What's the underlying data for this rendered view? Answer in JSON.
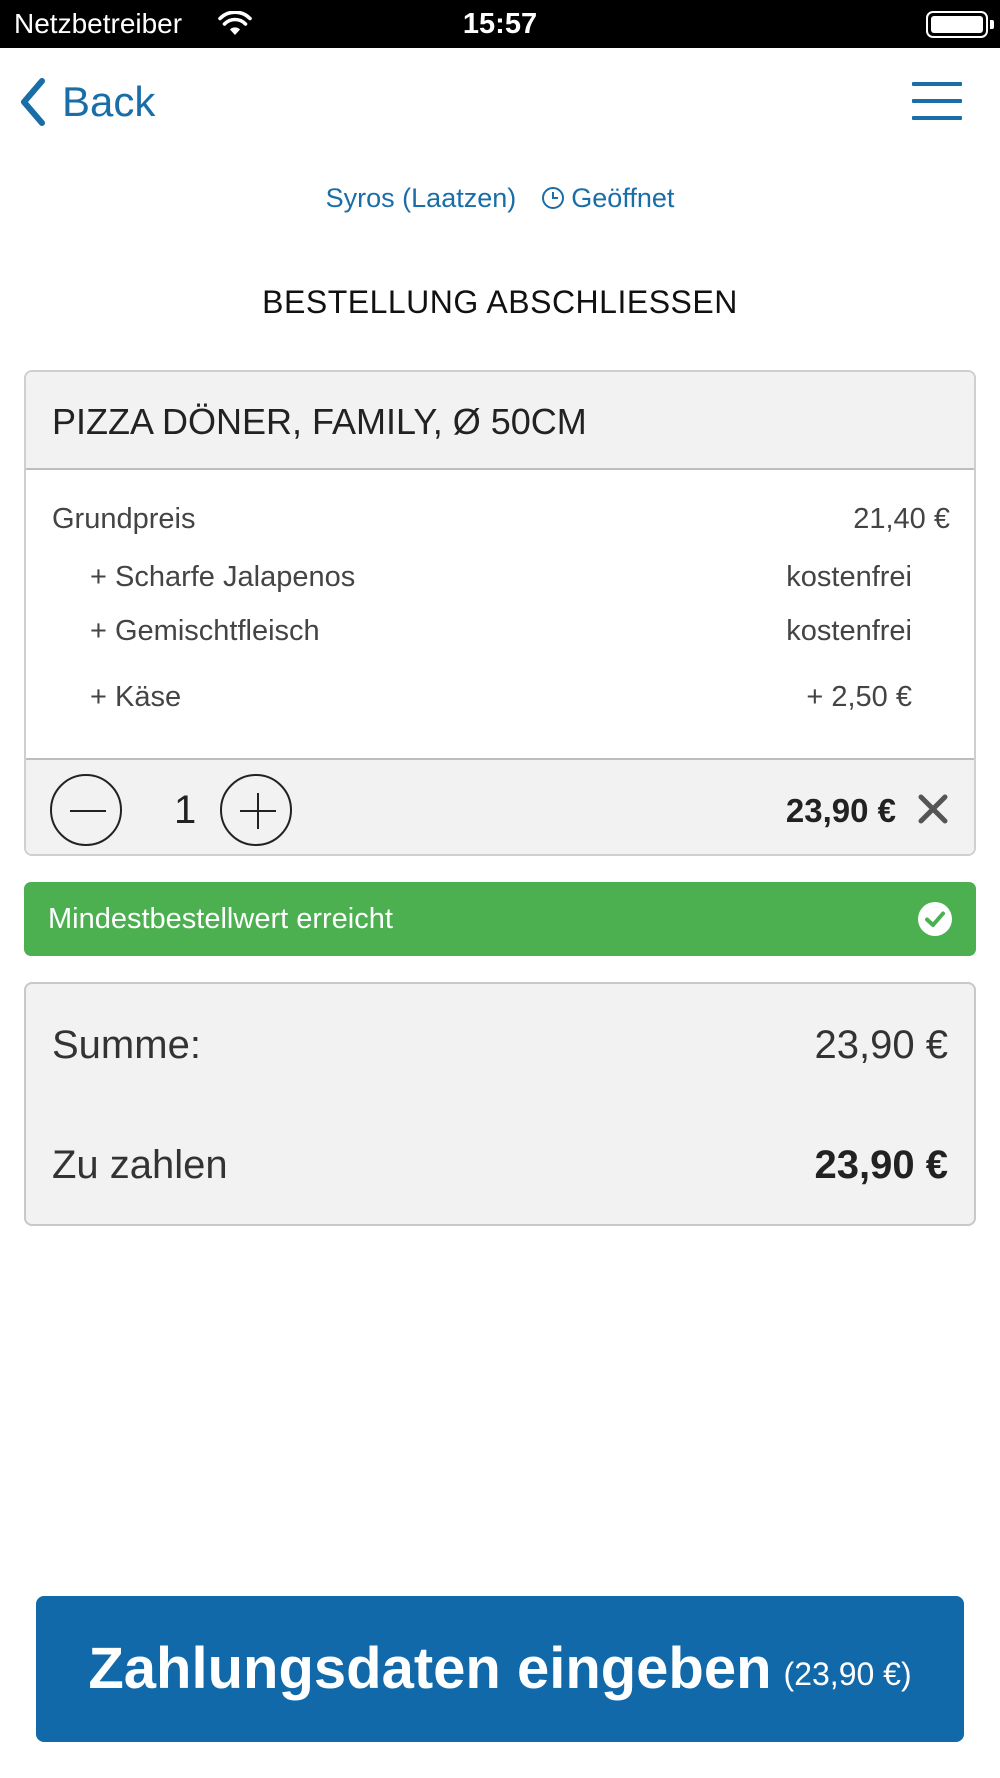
{
  "status_bar": {
    "carrier": "Netzbetreiber",
    "time": "15:57"
  },
  "nav": {
    "back_label": "Back"
  },
  "restaurant": {
    "name": "Syros",
    "location": "(Laatzen)",
    "status": "Geöffnet",
    "accent": "#1a6ea8"
  },
  "page": {
    "title": "BESTELLUNG ABSCHLIESSEN"
  },
  "cart": {
    "item_name": "PIZZA DÖNER, FAMILY, Ø 50CM",
    "base_label": "Grundpreis",
    "base_price": "21,40 €",
    "extras": [
      {
        "label": "+ Scharfe Jalapenos",
        "price": "kostenfrei"
      },
      {
        "label": "+ Gemischtfleisch",
        "price": "kostenfrei"
      },
      {
        "label": "+ Käse",
        "price": "+ 2,50 €"
      }
    ],
    "quantity": "1",
    "line_total": "23,90 €"
  },
  "min_order": {
    "text": "Mindestbestellwert erreicht",
    "color": "#4caf50"
  },
  "summary": {
    "sum_label": "Summe:",
    "sum_value": "23,90 €",
    "pay_label": "Zu zahlen",
    "pay_value": "23,90 €"
  },
  "cta": {
    "label": "Zahlungsdaten eingeben",
    "amount": "(23,90 €)",
    "color": "#1169a9"
  }
}
